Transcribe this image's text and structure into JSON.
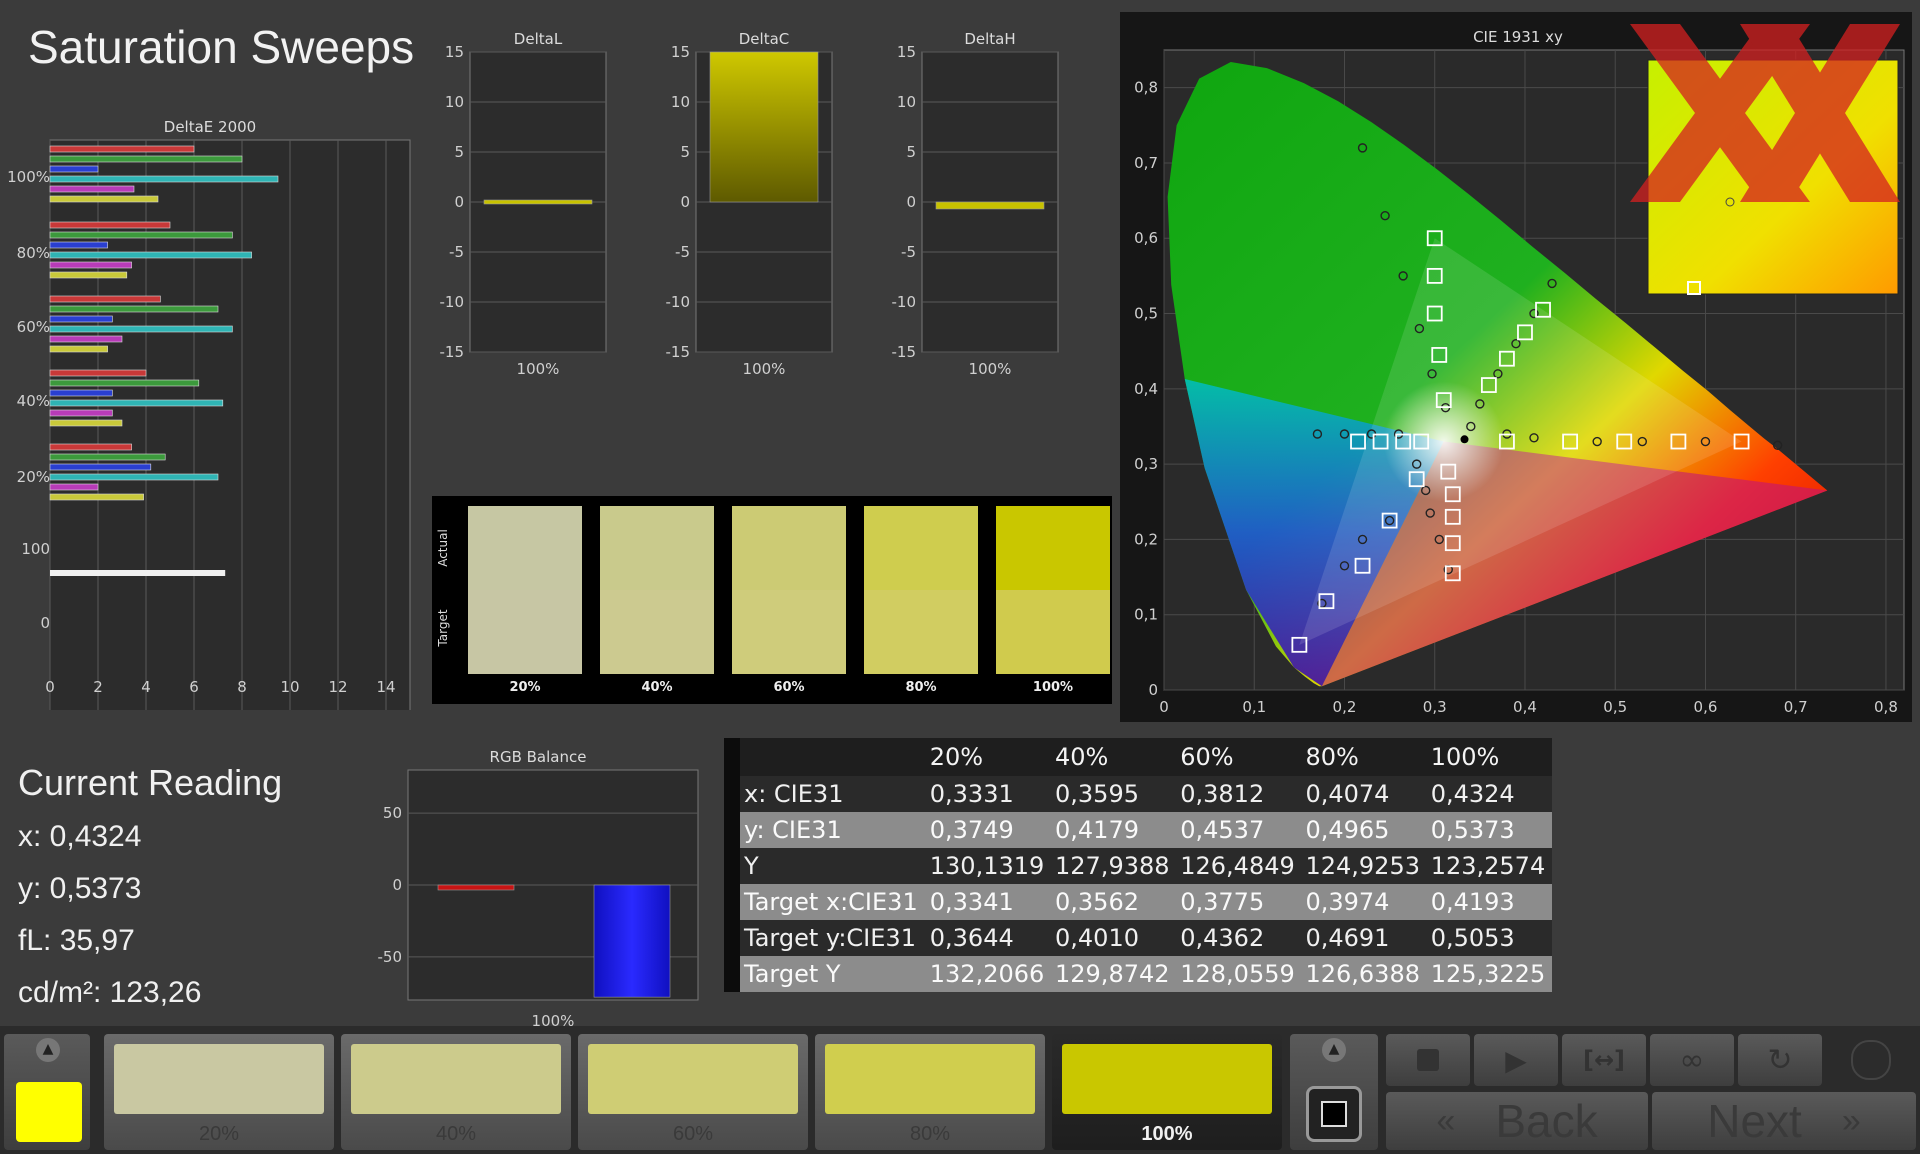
{
  "title": "Saturation Sweeps",
  "deltaE": {
    "title": "DeltaE 2000",
    "row_labels": [
      "100%",
      "80%",
      "60%",
      "40%",
      "20%",
      "100",
      "0"
    ],
    "x_ticks": [
      "0",
      "2",
      "4",
      "6",
      "8",
      "10",
      "12",
      "14"
    ]
  },
  "delta_charts": [
    {
      "title": "DeltaL",
      "xlabel": "100%",
      "value": 0
    },
    {
      "title": "DeltaC",
      "xlabel": "100%",
      "value": 15
    },
    {
      "title": "DeltaH",
      "xlabel": "100%",
      "value": -0.7
    }
  ],
  "delta_y_ticks": [
    "15",
    "10",
    "5",
    "0",
    "-5",
    "-10",
    "-15"
  ],
  "swatches": {
    "actual_label": "Actual",
    "target_label": "Target",
    "items": [
      {
        "label": "20%",
        "actual": "#c6c7a3",
        "target": "#c7c6a4"
      },
      {
        "label": "40%",
        "actual": "#c9ca8c",
        "target": "#ccca90"
      },
      {
        "label": "60%",
        "actual": "#cccb74",
        "target": "#cfcc7b"
      },
      {
        "label": "80%",
        "actual": "#cfcd4e",
        "target": "#d1cd61"
      },
      {
        "label": "100%",
        "actual": "#c9c700",
        "target": "#d0cb4d"
      }
    ]
  },
  "cie": {
    "title": "CIE 1931 xy",
    "x_ticks": [
      "0",
      "0,1",
      "0,2",
      "0,3",
      "0,4",
      "0,5",
      "0,6",
      "0,7",
      "0,8"
    ],
    "y_ticks": [
      "0",
      "0,1",
      "0,2",
      "0,3",
      "0,4",
      "0,5",
      "0,6",
      "0,7",
      "0,8"
    ],
    "targets": [
      [
        0.3127,
        0.329
      ],
      [
        0.3341,
        0.3644
      ],
      [
        0.3562,
        0.401
      ],
      [
        0.3775,
        0.4362
      ],
      [
        0.3974,
        0.4691
      ],
      [
        0.4193,
        0.5053
      ]
    ],
    "measured": [
      [
        0.3331,
        0.3749
      ],
      [
        0.3595,
        0.4179
      ],
      [
        0.3812,
        0.4537
      ],
      [
        0.4074,
        0.4965
      ],
      [
        0.4324,
        0.5373
      ]
    ]
  },
  "current_reading": {
    "title": "Current Reading",
    "x": "x: 0,4324",
    "y": "y: 0,5373",
    "fl": "fL: 35,97",
    "cdm2": "cd/m²: 123,26"
  },
  "rgb_balance": {
    "title": "RGB Balance",
    "xlabel": "100%",
    "y_ticks": [
      "50",
      "0",
      "-50"
    ],
    "red": -3,
    "blue": -78
  },
  "table": {
    "headers": [
      "",
      "20%",
      "40%",
      "60%",
      "80%",
      "100%"
    ],
    "rows": [
      [
        "x: CIE31",
        "0,3331",
        "0,3595",
        "0,3812",
        "0,4074",
        "0,4324"
      ],
      [
        "y: CIE31",
        "0,3749",
        "0,4179",
        "0,4537",
        "0,4965",
        "0,5373"
      ],
      [
        "Y",
        "130,1319",
        "127,9388",
        "126,4849",
        "124,9253",
        "123,2574"
      ],
      [
        "Target x:CIE31",
        "0,3341",
        "0,3562",
        "0,3775",
        "0,3974",
        "0,4193"
      ],
      [
        "Target y:CIE31",
        "0,3644",
        "0,4010",
        "0,4362",
        "0,4691",
        "0,5053"
      ],
      [
        "Target Y",
        "132,2066",
        "129,8742",
        "128,0559",
        "126,6388",
        "125,3225"
      ]
    ]
  },
  "bottom": {
    "steps": [
      "20%",
      "40%",
      "60%",
      "80%",
      "100%"
    ],
    "back_label": "Back",
    "next_label": "Next"
  }
}
